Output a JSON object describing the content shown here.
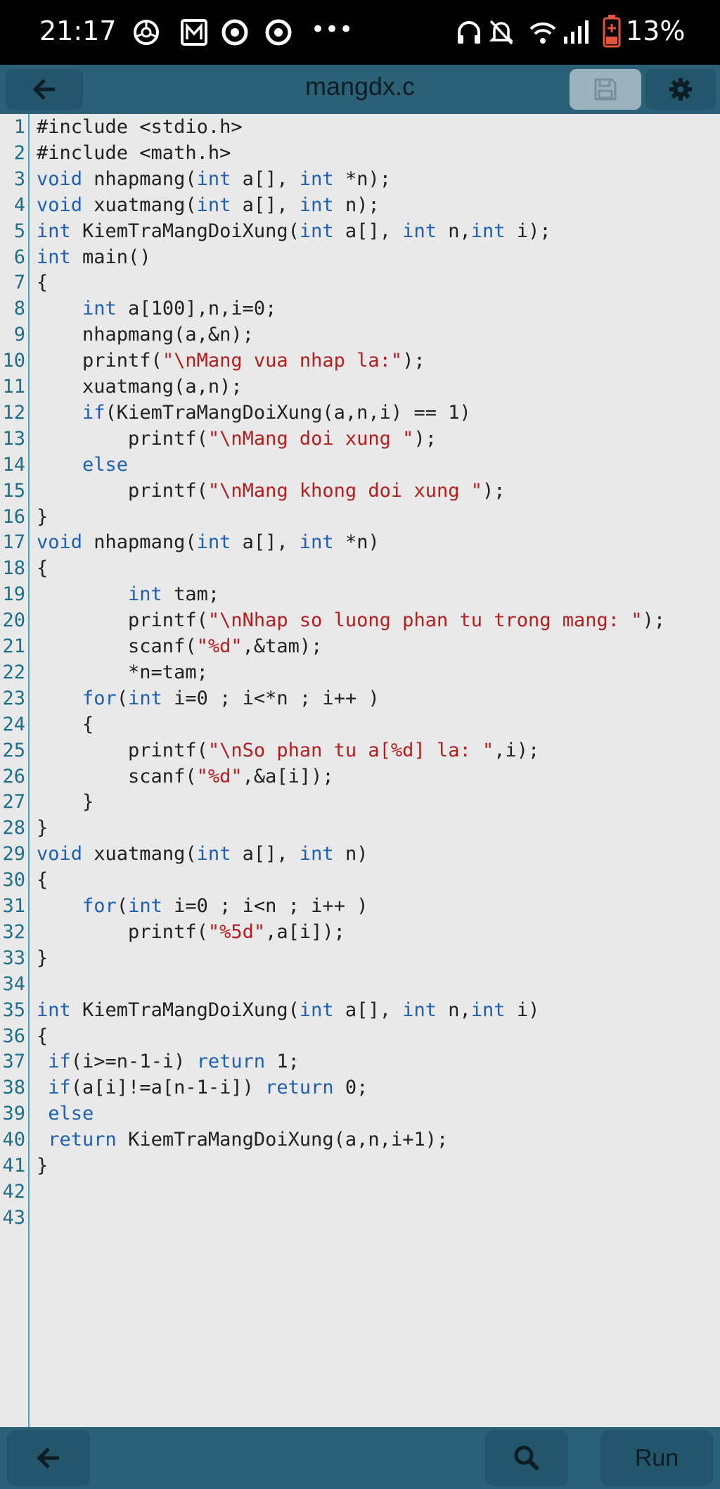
{
  "status_bar": {
    "time": "21:17",
    "battery": "13%"
  },
  "toolbar": {
    "title": "mangdx.c"
  },
  "bottom_bar": {
    "run_label": "Run"
  },
  "editor": {
    "lines": [
      [
        {
          "t": "#include <stdio.h>",
          "c": ""
        }
      ],
      [
        {
          "t": "#include <math.h>",
          "c": ""
        }
      ],
      [
        {
          "t": "void",
          "c": "kw"
        },
        {
          "t": " nhapmang(",
          "c": ""
        },
        {
          "t": "int",
          "c": "kw"
        },
        {
          "t": " a[], ",
          "c": ""
        },
        {
          "t": "int",
          "c": "kw"
        },
        {
          "t": " *n);",
          "c": ""
        }
      ],
      [
        {
          "t": "void",
          "c": "kw"
        },
        {
          "t": " xuatmang(",
          "c": ""
        },
        {
          "t": "int",
          "c": "kw"
        },
        {
          "t": " a[], ",
          "c": ""
        },
        {
          "t": "int",
          "c": "kw"
        },
        {
          "t": " n);",
          "c": ""
        }
      ],
      [
        {
          "t": "int",
          "c": "kw"
        },
        {
          "t": " KiemTraMangDoiXung(",
          "c": ""
        },
        {
          "t": "int",
          "c": "kw"
        },
        {
          "t": " a[], ",
          "c": ""
        },
        {
          "t": "int",
          "c": "kw"
        },
        {
          "t": " n,",
          "c": ""
        },
        {
          "t": "int",
          "c": "kw"
        },
        {
          "t": " i);",
          "c": ""
        }
      ],
      [
        {
          "t": "int",
          "c": "kw"
        },
        {
          "t": " main()",
          "c": ""
        }
      ],
      [
        {
          "t": "{",
          "c": ""
        }
      ],
      [
        {
          "t": "    ",
          "c": ""
        },
        {
          "t": "int",
          "c": "kw"
        },
        {
          "t": " a[100],n,i=0;",
          "c": ""
        }
      ],
      [
        {
          "t": "    nhapmang(a,&n);",
          "c": ""
        }
      ],
      [
        {
          "t": "    printf(",
          "c": ""
        },
        {
          "t": "\"\\nMang vua nhap la:\"",
          "c": "str"
        },
        {
          "t": ");",
          "c": ""
        }
      ],
      [
        {
          "t": "    xuatmang(a,n);",
          "c": ""
        }
      ],
      [
        {
          "t": "    ",
          "c": ""
        },
        {
          "t": "if",
          "c": "kw"
        },
        {
          "t": "(KiemTraMangDoiXung(a,n,i) == 1)",
          "c": ""
        }
      ],
      [
        {
          "t": "        printf(",
          "c": ""
        },
        {
          "t": "\"\\nMang doi xung \"",
          "c": "str"
        },
        {
          "t": ");",
          "c": ""
        }
      ],
      [
        {
          "t": "    ",
          "c": ""
        },
        {
          "t": "else",
          "c": "kw"
        }
      ],
      [
        {
          "t": "        printf(",
          "c": ""
        },
        {
          "t": "\"\\nMang khong doi xung \"",
          "c": "str"
        },
        {
          "t": ");",
          "c": ""
        }
      ],
      [
        {
          "t": "}",
          "c": ""
        }
      ],
      [
        {
          "t": "void",
          "c": "kw"
        },
        {
          "t": " nhapmang(",
          "c": ""
        },
        {
          "t": "int",
          "c": "kw"
        },
        {
          "t": " a[], ",
          "c": ""
        },
        {
          "t": "int",
          "c": "kw"
        },
        {
          "t": " *n)",
          "c": ""
        }
      ],
      [
        {
          "t": "{",
          "c": ""
        }
      ],
      [
        {
          "t": "        ",
          "c": ""
        },
        {
          "t": "int",
          "c": "kw"
        },
        {
          "t": " tam;",
          "c": ""
        }
      ],
      [
        {
          "t": "        printf(",
          "c": ""
        },
        {
          "t": "\"\\nNhap so luong phan tu trong mang: \"",
          "c": "str"
        },
        {
          "t": ");",
          "c": ""
        }
      ],
      [
        {
          "t": "        scanf(",
          "c": ""
        },
        {
          "t": "\"%d\"",
          "c": "str"
        },
        {
          "t": ",&tam);",
          "c": ""
        }
      ],
      [
        {
          "t": "        *n=tam;",
          "c": ""
        }
      ],
      [
        {
          "t": "    ",
          "c": ""
        },
        {
          "t": "for",
          "c": "kw"
        },
        {
          "t": "(",
          "c": ""
        },
        {
          "t": "int",
          "c": "kw"
        },
        {
          "t": " i=0 ; i<*n ; i++ )",
          "c": ""
        }
      ],
      [
        {
          "t": "    {",
          "c": ""
        }
      ],
      [
        {
          "t": "        printf(",
          "c": ""
        },
        {
          "t": "\"\\nSo phan tu a[%d] la: \"",
          "c": "str"
        },
        {
          "t": ",i);",
          "c": ""
        }
      ],
      [
        {
          "t": "        scanf(",
          "c": ""
        },
        {
          "t": "\"%d\"",
          "c": "str"
        },
        {
          "t": ",&a[i]);",
          "c": ""
        }
      ],
      [
        {
          "t": "    }",
          "c": ""
        }
      ],
      [
        {
          "t": "}",
          "c": ""
        }
      ],
      [
        {
          "t": "void",
          "c": "kw"
        },
        {
          "t": " xuatmang(",
          "c": ""
        },
        {
          "t": "int",
          "c": "kw"
        },
        {
          "t": " a[], ",
          "c": ""
        },
        {
          "t": "int",
          "c": "kw"
        },
        {
          "t": " n)",
          "c": ""
        }
      ],
      [
        {
          "t": "{",
          "c": ""
        }
      ],
      [
        {
          "t": "    ",
          "c": ""
        },
        {
          "t": "for",
          "c": "kw"
        },
        {
          "t": "(",
          "c": ""
        },
        {
          "t": "int",
          "c": "kw"
        },
        {
          "t": " i=0 ; i<n ; i++ )",
          "c": ""
        }
      ],
      [
        {
          "t": "        printf(",
          "c": ""
        },
        {
          "t": "\"%5d\"",
          "c": "str"
        },
        {
          "t": ",a[i]);",
          "c": ""
        }
      ],
      [
        {
          "t": "}",
          "c": ""
        }
      ],
      [],
      [
        {
          "t": "int",
          "c": "kw"
        },
        {
          "t": " KiemTraMangDoiXung(",
          "c": ""
        },
        {
          "t": "int",
          "c": "kw"
        },
        {
          "t": " a[], ",
          "c": ""
        },
        {
          "t": "int",
          "c": "kw"
        },
        {
          "t": " n,",
          "c": ""
        },
        {
          "t": "int",
          "c": "kw"
        },
        {
          "t": " i)",
          "c": ""
        }
      ],
      [
        {
          "t": "{",
          "c": ""
        }
      ],
      [
        {
          "t": " ",
          "c": ""
        },
        {
          "t": "if",
          "c": "kw"
        },
        {
          "t": "(i>=n-1-i) ",
          "c": ""
        },
        {
          "t": "return",
          "c": "kw"
        },
        {
          "t": " 1;",
          "c": ""
        }
      ],
      [
        {
          "t": " ",
          "c": ""
        },
        {
          "t": "if",
          "c": "kw"
        },
        {
          "t": "(a[i]!=a[n-1-i]) ",
          "c": ""
        },
        {
          "t": "return",
          "c": "kw"
        },
        {
          "t": " 0;",
          "c": ""
        }
      ],
      [
        {
          "t": " ",
          "c": ""
        },
        {
          "t": "else",
          "c": "kw"
        }
      ],
      [
        {
          "t": " ",
          "c": ""
        },
        {
          "t": "return",
          "c": "kw"
        },
        {
          "t": " KiemTraMangDoiXung(a,n,i+1);",
          "c": ""
        }
      ],
      [
        {
          "t": "}",
          "c": ""
        }
      ],
      [],
      []
    ]
  }
}
